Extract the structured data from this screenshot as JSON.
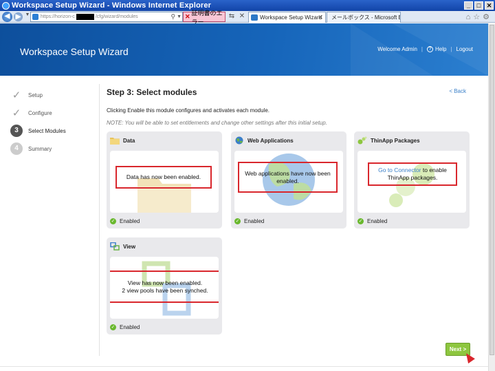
{
  "window": {
    "title": "Workspace Setup Wizard - Windows Internet Explorer"
  },
  "browser": {
    "address": {
      "prefix": "https://horizon-c",
      "suffix": "/cfg/wizard/modules"
    },
    "cert_error": "証明書のエラー",
    "tabs": [
      {
        "label": "Workspace Setup Wizard",
        "active": true
      },
      {
        "label": "メールボックス - Microsoft Exch...",
        "active": false
      }
    ]
  },
  "header": {
    "app_title": "Workspace Setup Wizard",
    "welcome": "Welcome Admin",
    "help": "Help",
    "logout": "Logout"
  },
  "steps": [
    {
      "label": "Setup",
      "status": "done",
      "number": ""
    },
    {
      "label": "Configure",
      "status": "done",
      "number": ""
    },
    {
      "label": "Select Modules",
      "status": "current",
      "number": "3"
    },
    {
      "label": "Summary",
      "status": "pending",
      "number": "4"
    }
  ],
  "main": {
    "title": "Step 3: Select modules",
    "back": "< Back",
    "description": "Clicking Enable this module configures and activates each module.",
    "note": "NOTE: You will be able to set entitlements and change other settings after this initial setup."
  },
  "modules": {
    "data": {
      "name": "Data",
      "message": "Data has now been enabled.",
      "status": "Enabled"
    },
    "web": {
      "name": "Web Applications",
      "message": "Web applications have now been enabled.",
      "status": "Enabled"
    },
    "thinapp": {
      "name": "ThinApp Packages",
      "link": "Go to Connector",
      "message": "to enable ThinApp packages.",
      "status": "Enabled"
    },
    "view": {
      "name": "View",
      "message_line1": "View has now been enabled.",
      "message_line2": "2 view pools have been synched.",
      "status": "Enabled"
    }
  },
  "footer": {
    "next": "Next >"
  },
  "colors": {
    "header_blue": "#1665ba",
    "next_green": "#8dc63f",
    "highlight_red": "#d9262c",
    "link_blue": "#3a7fc8"
  }
}
